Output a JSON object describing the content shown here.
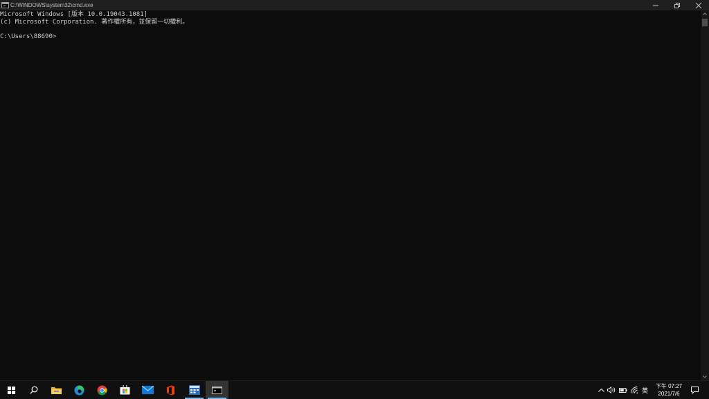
{
  "window": {
    "title": "C:\\WINDOWS\\system32\\cmd.exe",
    "icon": "cmd-icon",
    "controls": [
      "minimize-icon",
      "restore-icon",
      "close-icon"
    ]
  },
  "console": {
    "lines": [
      "Microsoft Windows [版本 10.0.19043.1081]",
      "(c) Microsoft Corporation. 著作權所有，並保留一切權利。",
      "",
      "C:\\Users\\88690>"
    ],
    "text_color": "#cccccc",
    "background": "#0c0c0c"
  },
  "taskbar": {
    "apps": [
      {
        "name": "start",
        "icon": "windows-logo-icon"
      },
      {
        "name": "search",
        "icon": "search-icon"
      },
      {
        "name": "file-explorer",
        "icon": "folder-icon"
      },
      {
        "name": "edge",
        "icon": "edge-icon"
      },
      {
        "name": "chrome",
        "icon": "chrome-icon"
      },
      {
        "name": "store",
        "icon": "store-icon"
      },
      {
        "name": "mail",
        "icon": "mail-icon"
      },
      {
        "name": "office",
        "icon": "office-icon"
      },
      {
        "name": "app-window",
        "icon": "app-window-icon"
      },
      {
        "name": "command-prompt",
        "icon": "cmd-icon"
      }
    ],
    "tray": {
      "icons": [
        "chevron-up-icon",
        "volume-icon",
        "battery-icon",
        "wifi-icon"
      ],
      "input_language": "英",
      "time": "下午 07:27",
      "date": "2021/7/6"
    },
    "accent": "#76b9ed"
  }
}
